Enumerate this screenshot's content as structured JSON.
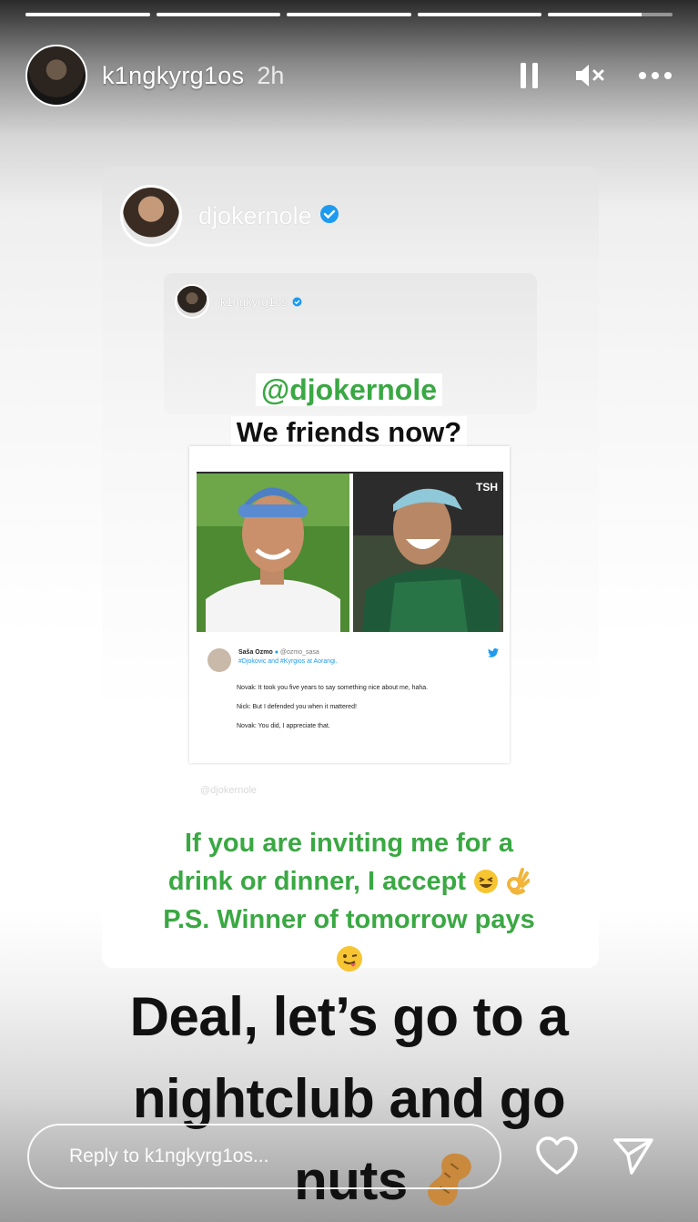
{
  "progress": [
    1.0,
    1.0,
    1.0,
    1.0,
    0.75
  ],
  "header": {
    "username": "k1ngkyrg1os",
    "time": "2h"
  },
  "shared_post": {
    "author": "djokernole",
    "inner_author": "k1ngkyrg1os",
    "mention": "@djokernole",
    "caption": "We friends now?",
    "photo_badge": "TSH",
    "tweet": {
      "author": "Saša Ozmo",
      "handle": "@ozmo_sasa",
      "text": "#Djokovic and #Kyrgios at Aorangi.",
      "lines": [
        "Novak: It took you five years to say something nice about me, haha.",
        "Nick: But I defended you when it mattered!",
        "Novak: You did, I appreciate that."
      ]
    },
    "faint_tag": "@djokernole"
  },
  "green_caption": [
    "If you are inviting me for a",
    "drink or dinner, I accept",
    "P.S. Winner of tomorrow pays"
  ],
  "big_caption": [
    "Deal, let’s go to a",
    "nightclub and go",
    "nuts"
  ],
  "reply": {
    "placeholder": "Reply to k1ngkyrg1os..."
  },
  "icons": {
    "pause": "pause-icon",
    "mute": "mute-icon",
    "more": "more-icon",
    "verified": "verified-badge-icon",
    "like": "heart-icon",
    "share": "send-icon",
    "twitter": "twitter-bird-icon"
  },
  "colors": {
    "green_text": "#3aa843",
    "verified_blue": "#1d9bf0"
  }
}
